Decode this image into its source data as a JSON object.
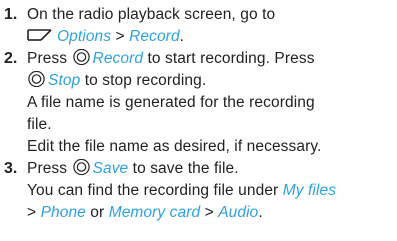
{
  "steps": [
    {
      "number": "1.",
      "lines": [
        {
          "text": "On the radio playback screen, go to"
        },
        {
          "icon": "softkey-icon",
          "kw1": "Options",
          "sep": " > ",
          "kw2": "Record",
          "tail": "."
        }
      ]
    },
    {
      "number": "2.",
      "lines": [
        {
          "pre": "Press ",
          "icon": "ok-key-icon",
          "kw": "Record",
          "post": " to start recording. Press"
        },
        {
          "icon": "ok-key-icon",
          "kw": "Stop",
          "post": " to stop recording."
        },
        {
          "text": "A file name is generated for the recording"
        },
        {
          "text": "file."
        },
        {
          "text": "Edit the file name as desired, if necessary."
        }
      ]
    },
    {
      "number": "3.",
      "lines": [
        {
          "pre": "Press ",
          "icon": "ok-key-icon",
          "kw": "Save",
          "post": " to save the file."
        },
        {
          "pre": "You can find the recording file under ",
          "kw": "My files"
        },
        {
          "pre": "> ",
          "kw1": "Phone",
          "mid": " or ",
          "kw2": "Memory card",
          "sep": " > ",
          "kw3": "Audio",
          "tail": "."
        }
      ]
    }
  ],
  "colors": {
    "keyword": "#2ea2dd",
    "text": "#222222"
  }
}
